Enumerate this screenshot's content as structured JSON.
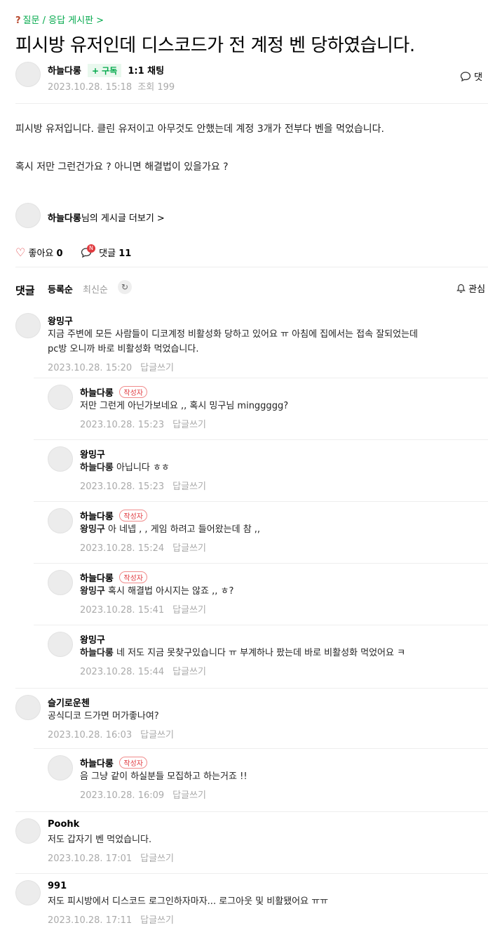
{
  "breadcrumb": {
    "icon": "question-icon",
    "text": "질문 / 응답 게시판 >"
  },
  "post": {
    "title": "피시방 유저인데 디스코드가 전 계정 벤 당하였습니다.",
    "author": "하늘다롱",
    "subscribe_label": "+ 구독",
    "chat_label": "1:1 채팅",
    "date": "2023.10.28. 15:18",
    "views": "조회 199",
    "comment_link": "댓",
    "body": [
      "피시방 유저입니다. 클린 유저이고 아무것도 안했는데 계정 3개가 전부다 벤을 먹었습니다.",
      "혹시 저만 그런건가요 ? 아니면 해결법이 있을가요 ?"
    ],
    "more_author": "하늘다롱",
    "more_suffix": "님의 게시글 더보기 >"
  },
  "reactions": {
    "like_label": "좋아요",
    "like_count": "0",
    "comment_label": "댓글",
    "comment_count": "11",
    "new_badge": "N"
  },
  "comments_section": {
    "heading": "댓글",
    "sort_registered": "등록순",
    "sort_recent": "최신순",
    "interest_label": "관심"
  },
  "comments": [
    {
      "name": "왕밍구",
      "badge": "",
      "mention": "",
      "lines": [
        "지금 주변에 모든 사람들이 디코계정 비활성화 당하고 있어요 ㅠ 아침에 집에서는 접속 잘되었는데",
        "pc방 오니까 바로 비활성화 먹었습니다."
      ],
      "date": "2023.10.28. 15:20",
      "reply": "답글쓰기"
    },
    {
      "name": "하늘다롱",
      "badge": "작성자",
      "mention": "",
      "lines": [
        "저만 그런게 아닌가보네요 ,, 혹시 밍구님 minggggg?"
      ],
      "date": "2023.10.28. 15:23",
      "reply": "답글쓰기"
    },
    {
      "name": "왕밍구",
      "badge": "",
      "mention": "하늘다롱",
      "lines": [
        " 아닙니다 ㅎㅎ"
      ],
      "date": "2023.10.28. 15:23",
      "reply": "답글쓰기"
    },
    {
      "name": "하늘다롱",
      "badge": "작성자",
      "mention": "왕밍구",
      "lines": [
        " 아 네넵 , , 게임 하려고 들어왔는데 참 ,,"
      ],
      "date": "2023.10.28. 15:24",
      "reply": "답글쓰기"
    },
    {
      "name": "하늘다롱",
      "badge": "작성자",
      "mention": "왕밍구",
      "lines": [
        " 혹시 해결법 아시지는 않죠 ,, ㅎ?"
      ],
      "date": "2023.10.28. 15:41",
      "reply": "답글쓰기"
    },
    {
      "name": "왕밍구",
      "badge": "",
      "mention": "하늘다롱",
      "lines": [
        " 네 저도 지금 못찾구있습니다 ㅠ 부계하나 팠는데 바로 비활성화 먹었어요 ㅋ"
      ],
      "date": "2023.10.28. 15:44",
      "reply": "답글쓰기"
    },
    {
      "name": "슬기로운첸",
      "badge": "",
      "mention": "",
      "lines": [
        "공식디코 드가면 머가좋나여?"
      ],
      "date": "2023.10.28. 16:03",
      "reply": "답글쓰기"
    },
    {
      "name": "하늘다롱",
      "badge": "작성자",
      "mention": "",
      "lines": [
        "음 그냥 같이 하실분들 모집하고 하는거죠 !!"
      ],
      "date": "2023.10.28. 16:09",
      "reply": "답글쓰기"
    },
    {
      "name": "Poohk",
      "badge": "",
      "mention": "",
      "lines": [
        "저도 갑자기 벤 먹었습니다."
      ],
      "date": "2023.10.28. 17:01",
      "reply": "답글쓰기"
    },
    {
      "name": "991",
      "badge": "",
      "mention": "",
      "lines": [
        "저도 피시방에서 디스코드 로그인하자마자... 로그아웃 및 비활됐어요 ㅠㅠ"
      ],
      "date": "2023.10.28. 17:11",
      "reply": "답글쓰기"
    }
  ]
}
